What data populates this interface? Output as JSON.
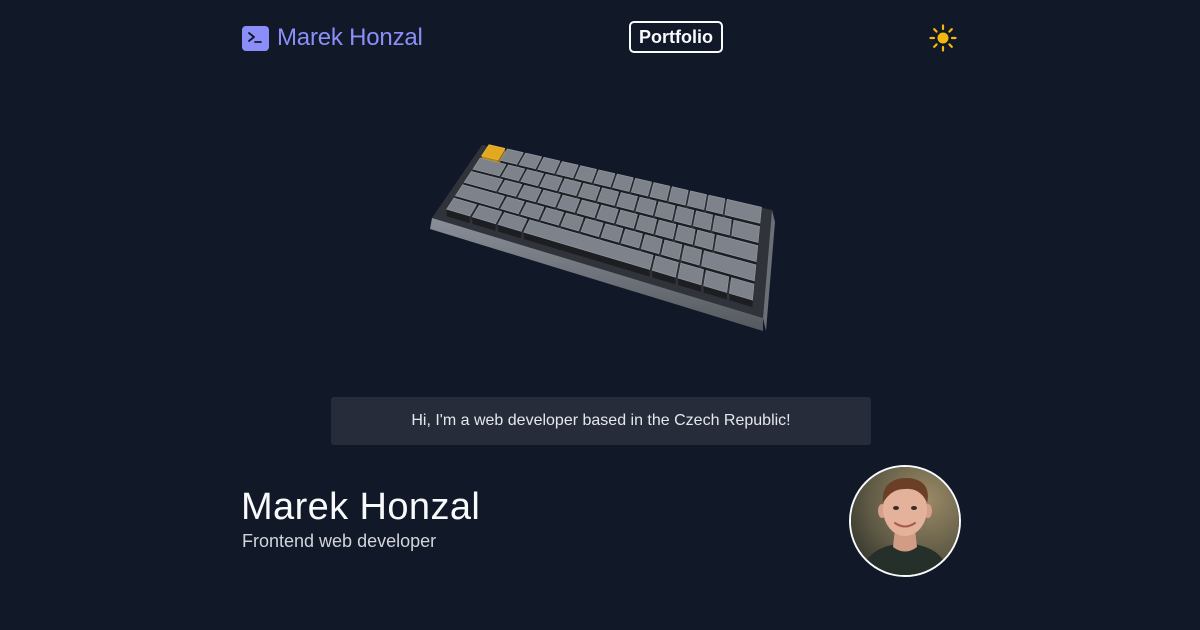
{
  "header": {
    "brand_name": "Marek Honzal",
    "nav_link": "Portfolio",
    "brand_icon": "terminal-icon",
    "theme_icon": "sun-icon"
  },
  "scene": {
    "description_icon": "keyboard-3d",
    "accent_key_color": "#e3a81f"
  },
  "intro": {
    "text": "Hi, I'm a web developer based in the Czech Republic!"
  },
  "profile": {
    "name": "Marek Honzal",
    "role": "Frontend web developer",
    "avatar_icon": "profile-photo"
  },
  "colors": {
    "background": "#111827",
    "accent": "#8b8ef8",
    "sun": "#f2b90d",
    "banner": "#262c3a"
  }
}
